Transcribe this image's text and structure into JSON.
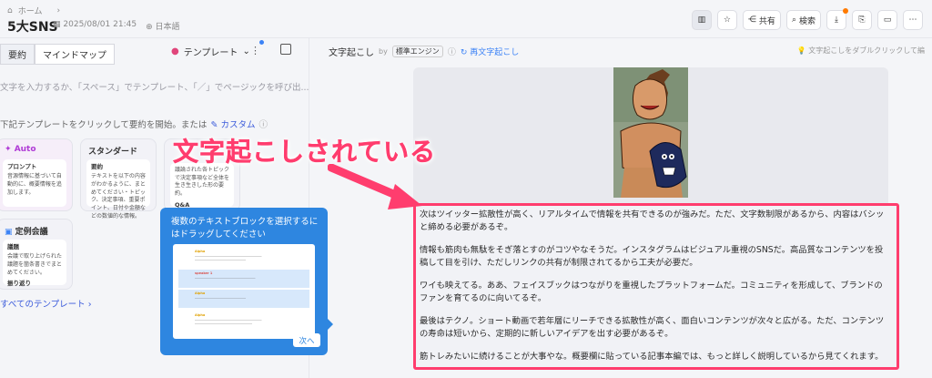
{
  "header": {
    "breadcrumb_home": "ホーム",
    "title": "5大SNS",
    "date": "2025/08/01 21:45",
    "language": "日本語",
    "share_label": "共有",
    "search_label": "検索"
  },
  "left": {
    "tab_summary": "要約",
    "tab_mindmap": "マインドマップ",
    "template_select": "テンプレート",
    "input_placeholder": "文字を入力するか、「スペース」でテンプレート、「／」でページックを呼び出...",
    "hint_text": "下記テンプレートをクリックして要約を開始。または",
    "hint_custom": "カスタム",
    "cards": {
      "auto": {
        "title": "Auto",
        "inner_title": "プロンプト",
        "inner_text": "音源情報に基づいて自動的に、概要情報を追加します。"
      },
      "standard": {
        "title": "スタンダード",
        "inner_title": "要約",
        "inner_text": "テキストを以下の内容がわかるように、まとめてください・トピック、決定事項、重要ポイント、日付や金額などの数値的な情報。"
      },
      "third": {
        "inner_text": "議論された各トピックで決定事項など全体を生き生きした形の要約。",
        "inner_title2": "Q&A"
      },
      "meeting": {
        "title": "定例会議",
        "inner_title": "議題",
        "inner_text": "会議で取り上げられた議題を箇条書きでまとめてください。",
        "inner_sub": "振り返り"
      }
    },
    "all_templates": "すべてのテンプレート"
  },
  "tooltip": {
    "text": "複数のテキストブロックを選択するにはドラッグしてください",
    "next_label": "次へ",
    "rows": [
      {
        "speaker": "Alpha"
      },
      {
        "speaker": "speaker 1"
      },
      {
        "speaker": "Alpha"
      },
      {
        "speaker": "Alpha"
      }
    ]
  },
  "right": {
    "title": "文字起こし",
    "by": "by",
    "engine": "標準エンジン",
    "retranscribe": "再文字起こし",
    "hint": "文字起こしをダブルクリックして編"
  },
  "overlay": {
    "label": "文字起こしされている"
  },
  "transcript": {
    "p1": "次はツイッター拡散性が高く、リアルタイムで情報を共有できるのが強みだ。ただ、文字数制限があるから、内容はバシッと締める必要があるぞ。",
    "p2": "情報も筋肉も無駄をそぎ落とすのがコツやなそうだ。インスタグラムはビジュアル重視のSNSだ。高品質なコンテンツを投稿して目を引け、ただしリンクの共有が制限されてるから工夫が必要だ。",
    "p3": "ワイも映えてる。ああ、フェイスブックはつながりを重視したプラットフォームだ。コミュニティを形成して、ブランドのファンを育てるのに向いてるぞ。",
    "p4": "最後はテクノ。ショート動画で若年層にリーチできる拡散性が高く、面白いコンテンツが次々と広がる。ただ、コンテンツの寿命は短いから、定期的に新しいアイデアを出す必要があるぞ。",
    "p5": "筋トレみたいに続けることが大事やな。概要欄に貼っている記事本編では、もっと詳しく説明しているから見てくれます。"
  },
  "colors": {
    "accent_pink": "#ff3d6e",
    "tooltip_blue": "#2e86e0",
    "link_blue": "#3b5bdb"
  }
}
